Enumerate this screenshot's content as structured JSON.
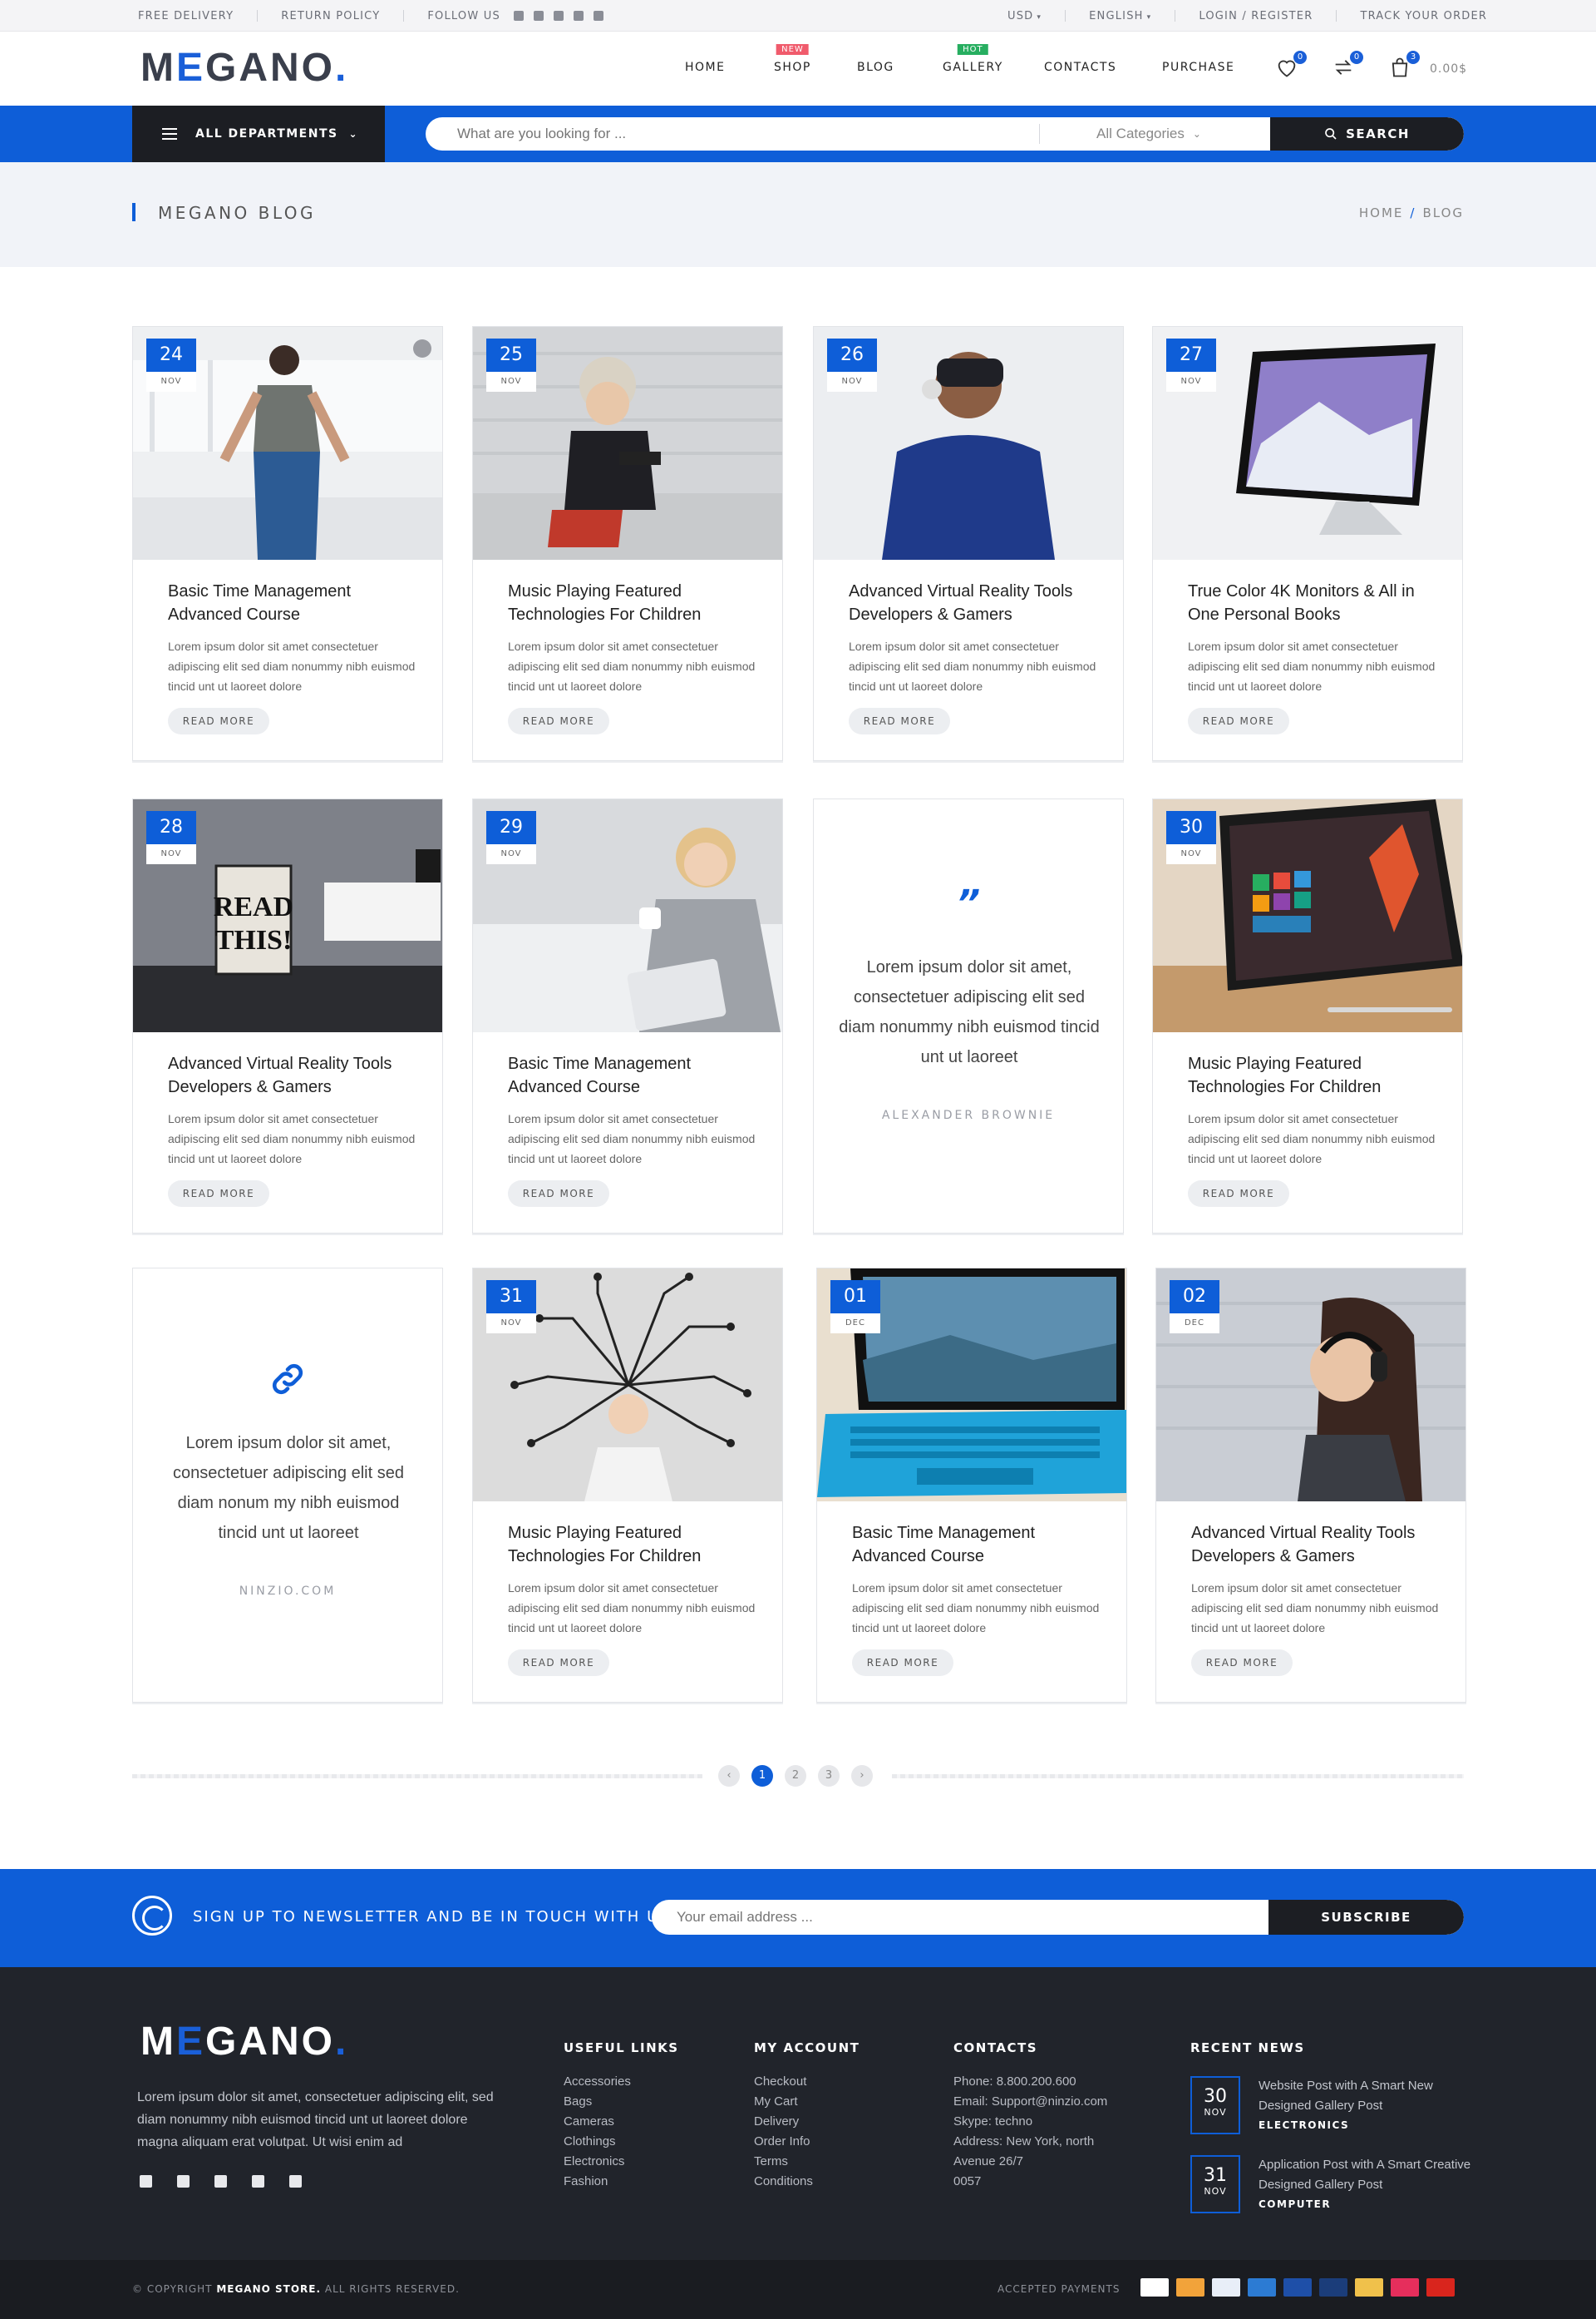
{
  "topbar": {
    "left": [
      "FREE DELIVERY",
      "RETURN POLICY",
      "FOLLOW US"
    ],
    "social_icons": [
      "facebook-icon",
      "twitter-icon",
      "linkedin-icon",
      "pinterest-icon",
      "mail-icon"
    ],
    "currency": "USD",
    "language": "ENGLISH",
    "login": "LOGIN / REGISTER",
    "track": "TRACK YOUR ORDER"
  },
  "header": {
    "logo_m": "M",
    "logo_e": "E",
    "logo_rest": "GANO",
    "logo_dot": ".",
    "nav": [
      {
        "label": "HOME",
        "tag": ""
      },
      {
        "label": "SHOP",
        "tag": "NEW"
      },
      {
        "label": "BLOG",
        "tag": ""
      },
      {
        "label": "GALLERY",
        "tag": "HOT"
      },
      {
        "label": "CONTACTS",
        "tag": ""
      },
      {
        "label": "PURCHASE",
        "tag": ""
      }
    ],
    "wishlist_count": "0",
    "compare_count": "0",
    "cart_count": "3",
    "cart_total": "0.00$"
  },
  "searchbar": {
    "departments": "ALL DEPARTMENTS",
    "placeholder": "What are you looking for ...",
    "category": "All Categories",
    "button": "SEARCH"
  },
  "page": {
    "title": "MEGANO BLOG",
    "breadcrumb": [
      "HOME",
      "BLOG"
    ]
  },
  "posts": [
    {
      "day": "24",
      "month": "NOV",
      "title": "Basic Time Management Advanced Course",
      "excerpt": "Lorem ipsum dolor sit amet consectetuer adipiscing elit sed diam nonummy nibh euismod tincid  unt ut laoreet dolore",
      "more": "READ MORE"
    },
    {
      "day": "25",
      "month": "NOV",
      "title": "Music Playing Featured Technologies For Children",
      "excerpt": "Lorem ipsum dolor sit amet consectetuer adipiscing elit sed diam nonummy nibh euismod tincid  unt ut laoreet dolore",
      "more": "READ MORE"
    },
    {
      "day": "26",
      "month": "NOV",
      "title": "Advanced Virtual Reality Tools Developers & Gamers",
      "excerpt": "Lorem ipsum dolor sit amet consectetuer adipiscing elit sed diam nonummy nibh euismod tincid  unt ut laoreet dolore",
      "more": "READ MORE"
    },
    {
      "day": "27",
      "month": "NOV",
      "title": "True Color 4K Monitors & All in One Personal Books",
      "excerpt": "Lorem ipsum dolor sit amet consectetuer adipiscing elit sed diam nonummy nibh euismod tincid  unt ut laoreet dolore",
      "more": "READ MORE"
    },
    {
      "day": "28",
      "month": "NOV",
      "title": "Advanced Virtual Reality Tools Developers & Gamers",
      "excerpt": "Lorem ipsum dolor sit amet consectetuer adipiscing elit sed diam nonummy nibh euismod tincid  unt ut laoreet dolore",
      "more": "READ MORE"
    },
    {
      "day": "29",
      "month": "NOV",
      "title": "Basic Time Management Advanced Course",
      "excerpt": "Lorem ipsum dolor sit amet consectetuer adipiscing elit sed diam nonummy nibh euismod tincid  unt ut laoreet dolore",
      "more": "READ MORE"
    },
    {
      "day": "30",
      "month": "NOV",
      "title": "Music Playing Featured Technologies For Children",
      "excerpt": "Lorem ipsum dolor sit amet consectetuer adipiscing elit sed diam nonummy nibh euismod tincid  unt ut laoreet dolore",
      "more": "READ MORE"
    },
    {
      "day": "31",
      "month": "NOV",
      "title": "Music Playing Featured Technologies For Children",
      "excerpt": "Lorem ipsum dolor sit amet consectetuer adipiscing elit sed diam nonummy nibh euismod tincid  unt ut laoreet dolore",
      "more": "READ MORE"
    },
    {
      "day": "01",
      "month": "DEC",
      "title": "Basic Time Management Advanced Course",
      "excerpt": "Lorem ipsum dolor sit amet consectetuer adipiscing elit sed diam nonummy nibh euismod tincid  unt ut laoreet dolore",
      "more": "READ MORE"
    },
    {
      "day": "02",
      "month": "DEC",
      "title": "Advanced Virtual Reality Tools Developers & Gamers",
      "excerpt": "Lorem ipsum dolor sit amet consectetuer adipiscing elit sed diam nonummy nibh euismod tincid  unt ut laoreet dolore",
      "more": "READ MORE"
    }
  ],
  "quotes": [
    {
      "mark": "”",
      "text": "Lorem ipsum dolor sit amet, consectetuer adipiscing elit sed diam nonummy nibh euismod tincid unt ut laoreet",
      "author": "ALEXANDER BROWNIE"
    },
    {
      "mark": "link",
      "text": "Lorem ipsum dolor sit amet, consectetuer adipiscing elit sed diam nonum my nibh euismod tincid unt ut laoreet",
      "author": "NINZIO.COM"
    }
  ],
  "pagination": [
    "1",
    "2",
    "3"
  ],
  "newsletter": {
    "text": "SIGN UP TO NEWSLETTER AND BE IN TOUCH WITH US.",
    "placeholder": "Your email address ...",
    "button": "SUBSCRIBE"
  },
  "footer": {
    "about": "Lorem ipsum dolor sit amet, consectetuer adipiscing elit, sed diam nonummy nibh euismod tincid  unt ut laoreet dolore magna aliquam erat volutpat. Ut wisi enim ad",
    "useful_links": {
      "title": "USEFUL LINKS",
      "items": [
        "Accessories",
        "Bags",
        "Cameras",
        "Clothings",
        "Electronics",
        "Fashion"
      ]
    },
    "my_account": {
      "title": "MY ACCOUNT",
      "items": [
        "Checkout",
        "My Cart",
        "Delivery",
        "Order Info",
        "Terms",
        "Conditions"
      ]
    },
    "contacts": {
      "title": "CONTACTS",
      "items": [
        "Phone: 8.800.200.600",
        "Email: Support@ninzio.com",
        "Skype: techno",
        "Address: New York, north",
        "Avenue 26/7",
        "0057"
      ]
    },
    "recent_news": {
      "title": "RECENT NEWS",
      "items": [
        {
          "day": "30",
          "month": "NOV",
          "title": "Website Post with A Smart New Designed Gallery Post",
          "category": "ELECTRONICS"
        },
        {
          "day": "31",
          "month": "NOV",
          "title": "Application Post with A Smart Creative Designed Gallery Post",
          "category": "COMPUTER"
        }
      ]
    }
  },
  "copyright": {
    "prefix": "© COPYRIGHT",
    "brand": "MEGANO STORE.",
    "suffix": "ALL RIGHTS RESERVED.",
    "payments_label": "ACCEPTED PAYMENTS"
  },
  "colors": {
    "accent": "#0e5ed8",
    "dark": "#1c1e23",
    "footer": "#21242b"
  }
}
